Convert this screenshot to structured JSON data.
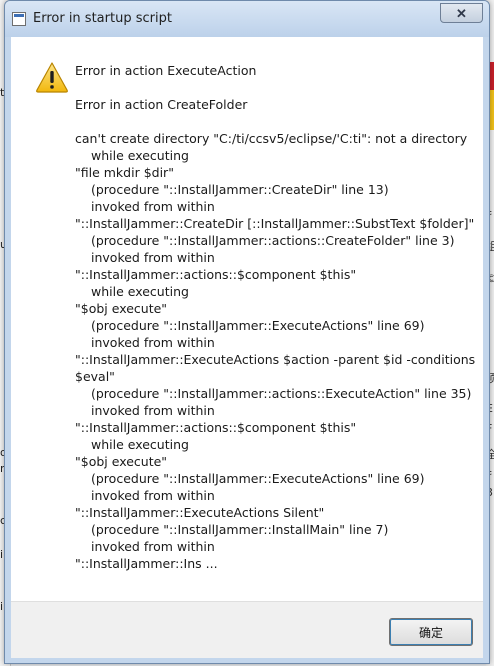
{
  "dialog": {
    "title": "Error in startup script",
    "close_symbol": "✕",
    "ok_label": "确定"
  },
  "message": {
    "lines": [
      {
        "text": "Error in action ExecuteAction",
        "indent": false
      },
      {
        "text": "",
        "indent": false
      },
      {
        "text": "Error in action CreateFolder",
        "indent": false
      },
      {
        "text": "",
        "indent": false
      },
      {
        "text": "can't create directory \"C:/ti/ccsv5/eclipse/'C:ti\": not a directory",
        "indent": false
      },
      {
        "text": "while executing",
        "indent": true
      },
      {
        "text": "\"file mkdir $dir\"",
        "indent": false
      },
      {
        "text": "(procedure \"::InstallJammer::CreateDir\" line 13)",
        "indent": true
      },
      {
        "text": "invoked from within",
        "indent": true
      },
      {
        "text": "\"::InstallJammer::CreateDir [::InstallJammer::SubstText $folder]\"",
        "indent": false
      },
      {
        "text": "(procedure \"::InstallJammer::actions::CreateFolder\" line 3)",
        "indent": true
      },
      {
        "text": "invoked from within",
        "indent": true
      },
      {
        "text": "\"::InstallJammer::actions::$component $this\"",
        "indent": false
      },
      {
        "text": "while executing",
        "indent": true
      },
      {
        "text": "\"$obj execute\"",
        "indent": false
      },
      {
        "text": "(procedure \"::InstallJammer::ExecuteActions\" line 69)",
        "indent": true
      },
      {
        "text": "invoked from within",
        "indent": true
      },
      {
        "text": "\"::InstallJammer::ExecuteActions $action -parent $id -conditions",
        "indent": false
      },
      {
        "text": "$eval\"",
        "indent": false
      },
      {
        "text": "(procedure \"::InstallJammer::actions::ExecuteAction\" line 35)",
        "indent": true
      },
      {
        "text": "invoked from within",
        "indent": true
      },
      {
        "text": "\"::InstallJammer::actions::$component $this\"",
        "indent": false
      },
      {
        "text": "while executing",
        "indent": true
      },
      {
        "text": "\"$obj execute\"",
        "indent": false
      },
      {
        "text": "(procedure \"::InstallJammer::ExecuteActions\" line 69)",
        "indent": true
      },
      {
        "text": "invoked from within",
        "indent": true
      },
      {
        "text": "\"::InstallJammer::ExecuteActions Silent\"",
        "indent": false
      },
      {
        "text": "(procedure \"::InstallJammer::InstallMain\" line 7)",
        "indent": true
      },
      {
        "text": "invoked from within",
        "indent": true
      },
      {
        "text": "\"::InstallJammer::Ins ...",
        "indent": false
      }
    ]
  },
  "icons": {
    "title": "window-icon",
    "warning": "warning-icon",
    "close": "close-icon"
  },
  "background": {
    "left_fragments": [
      "t",
      "up",
      "oc",
      "n",
      "ct",
      "ir",
      "ir"
    ],
    "right_fragments": [
      "扌",
      "组",
      "©",
      "项",
      "E",
      "F",
      "全",
      "扌",
      "3"
    ]
  },
  "colors": {
    "titlebar": "#c3d6ec",
    "warning_yellow": "#f5c518",
    "button_focus": "#3c7fb1"
  }
}
